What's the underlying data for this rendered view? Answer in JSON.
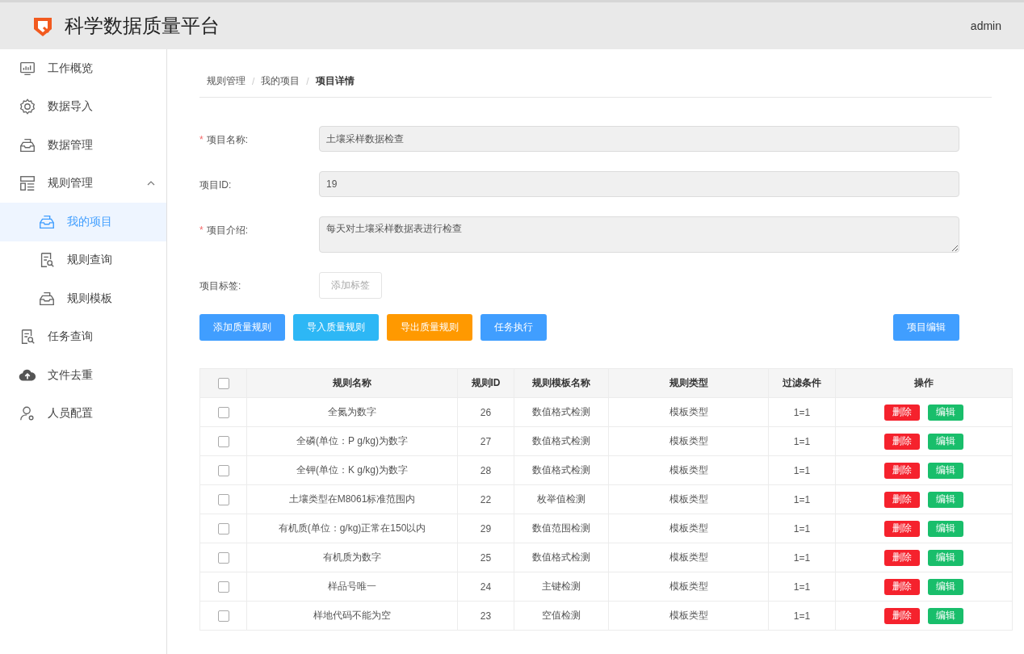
{
  "header": {
    "title": "科学数据质量平台",
    "user": "admin"
  },
  "sidebar": {
    "items": [
      {
        "label": "工作概览",
        "kind": "monitor",
        "selected": false
      },
      {
        "label": "数据导入",
        "kind": "gear",
        "selected": false
      },
      {
        "label": "数据管理",
        "kind": "tray",
        "selected": false
      },
      {
        "label": "规则管理",
        "kind": "layout",
        "selected": false,
        "expanded": true,
        "children": [
          {
            "label": "我的项目",
            "kind": "tray",
            "selected": true
          },
          {
            "label": "规则查询",
            "kind": "docsearch",
            "selected": false
          },
          {
            "label": "规则模板",
            "kind": "tray",
            "selected": false
          }
        ]
      },
      {
        "label": "任务查询",
        "kind": "docsearch",
        "selected": false
      },
      {
        "label": "文件去重",
        "kind": "cloud",
        "selected": false
      },
      {
        "label": "人员配置",
        "kind": "person",
        "selected": false
      }
    ]
  },
  "breadcrumb": {
    "separator": "/",
    "items": [
      "规则管理",
      "我的项目",
      "项目详情"
    ]
  },
  "form": [
    {
      "label": "项目名称:",
      "required_mark": "*",
      "kind": "input",
      "value": "土壤采样数据检查"
    },
    {
      "label": "项目ID:",
      "kind": "input",
      "value": "19"
    },
    {
      "label": "项目介绍:",
      "required_mark": "*",
      "kind": "textarea",
      "value": "每天对土壤采样数据表进行检查"
    },
    {
      "label": "项目标签:",
      "kind": "tag",
      "value": "添加标签"
    }
  ],
  "actions": [
    {
      "label": "添加质量规则",
      "color": "#409eff"
    },
    {
      "label": "导入质量规则",
      "color": "#2db7f5"
    },
    {
      "label": "导出质量规则",
      "color": "#ff9900"
    },
    {
      "label": "任务执行",
      "color": "#409eff"
    }
  ],
  "edit_button": "项目编辑",
  "table": {
    "columns": [
      "规则名称",
      "规则ID",
      "规则模板名称",
      "规则类型",
      "过滤条件",
      "操作"
    ],
    "all_checked": false,
    "rows": [
      {
        "checked": false,
        "cells": [
          "全氮为数字",
          "26",
          "数值格式检测",
          "模板类型",
          "1=1"
        ],
        "actions": [
          "删除",
          "编辑"
        ]
      },
      {
        "checked": false,
        "cells": [
          "全磷(单位：P g/kg)为数字",
          "27",
          "数值格式检测",
          "模板类型",
          "1=1"
        ],
        "actions": [
          "删除",
          "编辑"
        ]
      },
      {
        "checked": false,
        "cells": [
          "全钾(单位：K g/kg)为数字",
          "28",
          "数值格式检测",
          "模板类型",
          "1=1"
        ],
        "actions": [
          "删除",
          "编辑"
        ]
      },
      {
        "checked": false,
        "cells": [
          "土壤类型在M8061标准范围内",
          "22",
          "枚举值检测",
          "模板类型",
          "1=1"
        ],
        "actions": [
          "删除",
          "编辑"
        ]
      },
      {
        "checked": false,
        "cells": [
          "有机质(单位：g/kg)正常在150以内",
          "29",
          "数值范围检测",
          "模板类型",
          "1=1"
        ],
        "actions": [
          "删除",
          "编辑"
        ]
      },
      {
        "checked": false,
        "cells": [
          "有机质为数字",
          "25",
          "数值格式检测",
          "模板类型",
          "1=1"
        ],
        "actions": [
          "删除",
          "编辑"
        ]
      },
      {
        "checked": false,
        "cells": [
          "样品号唯一",
          "24",
          "主键检测",
          "模板类型",
          "1=1"
        ],
        "actions": [
          "删除",
          "编辑"
        ]
      },
      {
        "checked": false,
        "cells": [
          "样地代码不能为空",
          "23",
          "空值检测",
          "模板类型",
          "1=1"
        ],
        "actions": [
          "删除",
          "编辑"
        ]
      }
    ]
  }
}
